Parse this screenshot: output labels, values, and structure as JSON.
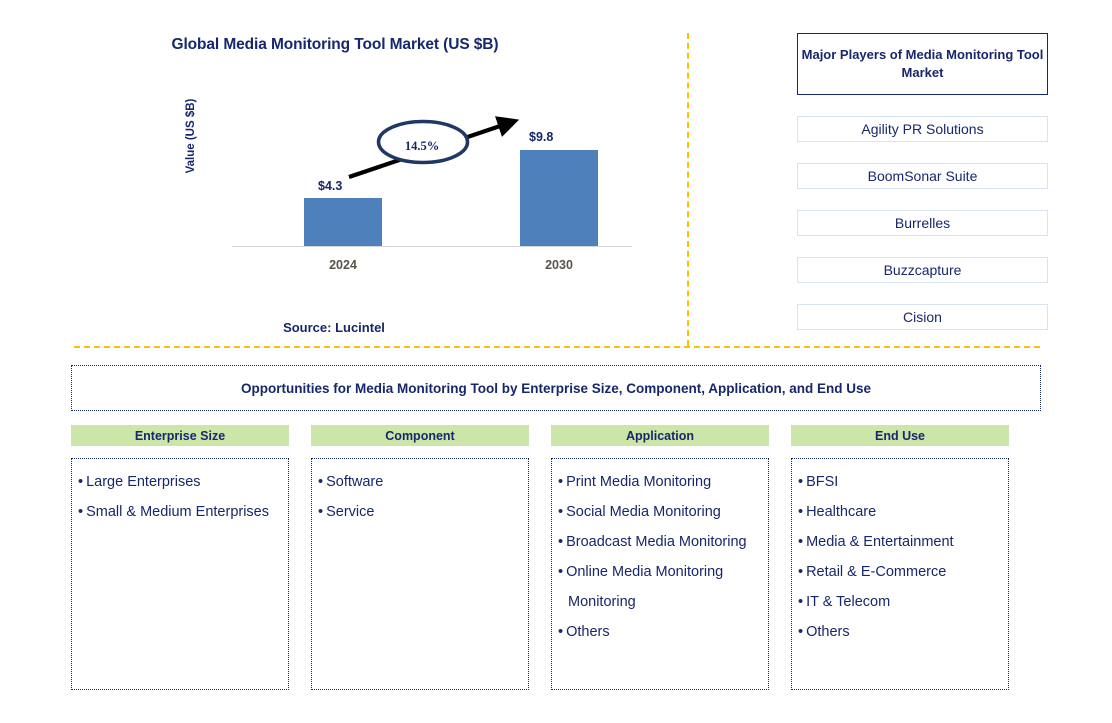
{
  "chart_panel": {
    "title": "Global Media Monitoring Tool Market (US $B)",
    "y_axis_label": "Value (US $B)",
    "source": "Source: Lucintel"
  },
  "chart_data": {
    "type": "bar",
    "title": "Global Media Monitoring Tool Market (US $B)",
    "categories": [
      "2024",
      "2030"
    ],
    "values": [
      4.3,
      9.8
    ],
    "data_labels": [
      "$4.3",
      "$9.8"
    ],
    "xlabel": "",
    "ylabel": "Value (US $B)",
    "ylim": [
      0,
      11
    ],
    "grid": false,
    "legend": "none",
    "bar_color": "#4E80BB",
    "annotations": [
      {
        "type": "cagr-arrow",
        "label": "14.5%",
        "from_category": "2024",
        "to_category": "2030"
      }
    ]
  },
  "players": {
    "header": "Major Players of Media Monitoring Tool Market",
    "items": [
      {
        "label": "Agility PR Solutions"
      },
      {
        "label": "BoomSonar Suite"
      },
      {
        "label": "Burrelles"
      },
      {
        "label": "Buzzcapture"
      },
      {
        "label": "Cision"
      }
    ]
  },
  "opportunities": {
    "banner": "Opportunities for Media Monitoring Tool by Enterprise Size, Component, Application, and End Use",
    "columns": [
      {
        "header": "Enterprise Size",
        "items": [
          "Large Enterprises",
          "Small & Medium Enterprises"
        ]
      },
      {
        "header": "Component",
        "items": [
          "Software",
          "Service"
        ]
      },
      {
        "header": "Application",
        "items": [
          "Print Media Monitoring",
          "Social Media Monitoring",
          "Broadcast Media Monitoring",
          "Online Media Monitoring Monitoring",
          "Others"
        ]
      },
      {
        "header": "End Use",
        "items": [
          "BFSI",
          "Healthcare",
          "Media & Entertainment",
          "Retail & E-Commerce",
          "IT & Telecom",
          "Others"
        ]
      }
    ]
  },
  "colors": {
    "navy": "#17276B",
    "bar_blue": "#4E80BB",
    "divider_gold": "#FFC000",
    "header_green": "#CCE6A9"
  }
}
